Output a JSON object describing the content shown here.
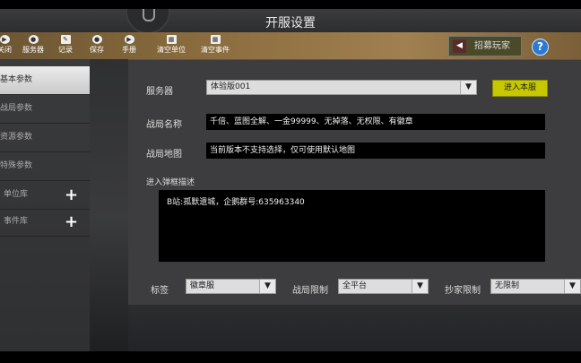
{
  "title": "开服设置",
  "toolbar": {
    "items": [
      {
        "label": "关闭",
        "icon": "close-icon"
      },
      {
        "label": "服务器",
        "icon": "server-icon"
      },
      {
        "label": "记录",
        "icon": "edit-icon"
      },
      {
        "label": "保存",
        "icon": "save-icon"
      },
      {
        "label": "手册",
        "icon": "play-icon"
      },
      {
        "label": "清空单位",
        "icon": "trash-icon"
      },
      {
        "label": "清空事件",
        "icon": "trash-icon"
      }
    ],
    "recruit_label": "招募玩家",
    "help_label": "?"
  },
  "sidebar": {
    "items": [
      {
        "label": "基本参数",
        "active": true
      },
      {
        "label": "战局参数"
      },
      {
        "label": "资源参数"
      },
      {
        "label": "特殊参数"
      },
      {
        "label": "单位库",
        "plus": "+"
      },
      {
        "label": "事件库",
        "plus": "+"
      }
    ]
  },
  "form": {
    "server_label": "服务器",
    "server_value": "体验版001",
    "enter_button": "进入本服",
    "match_name_label": "战局名称",
    "match_name_value": "千倍、蓝图全解、一金99999、无掉落、无权限、有徽章",
    "match_map_label": "战局地图",
    "match_map_value": "当前版本不支持选择，仅可使用默认地图",
    "popup_label": "进入弹框描述",
    "popup_value": "B站:孤默遗城，企鹅群号:635963340",
    "tag_label": "标签",
    "tag_value": "徽章服",
    "limit_label": "战局限制",
    "limit_value": "全平台",
    "copy_label": "抄家限制",
    "copy_value": "无限制"
  }
}
